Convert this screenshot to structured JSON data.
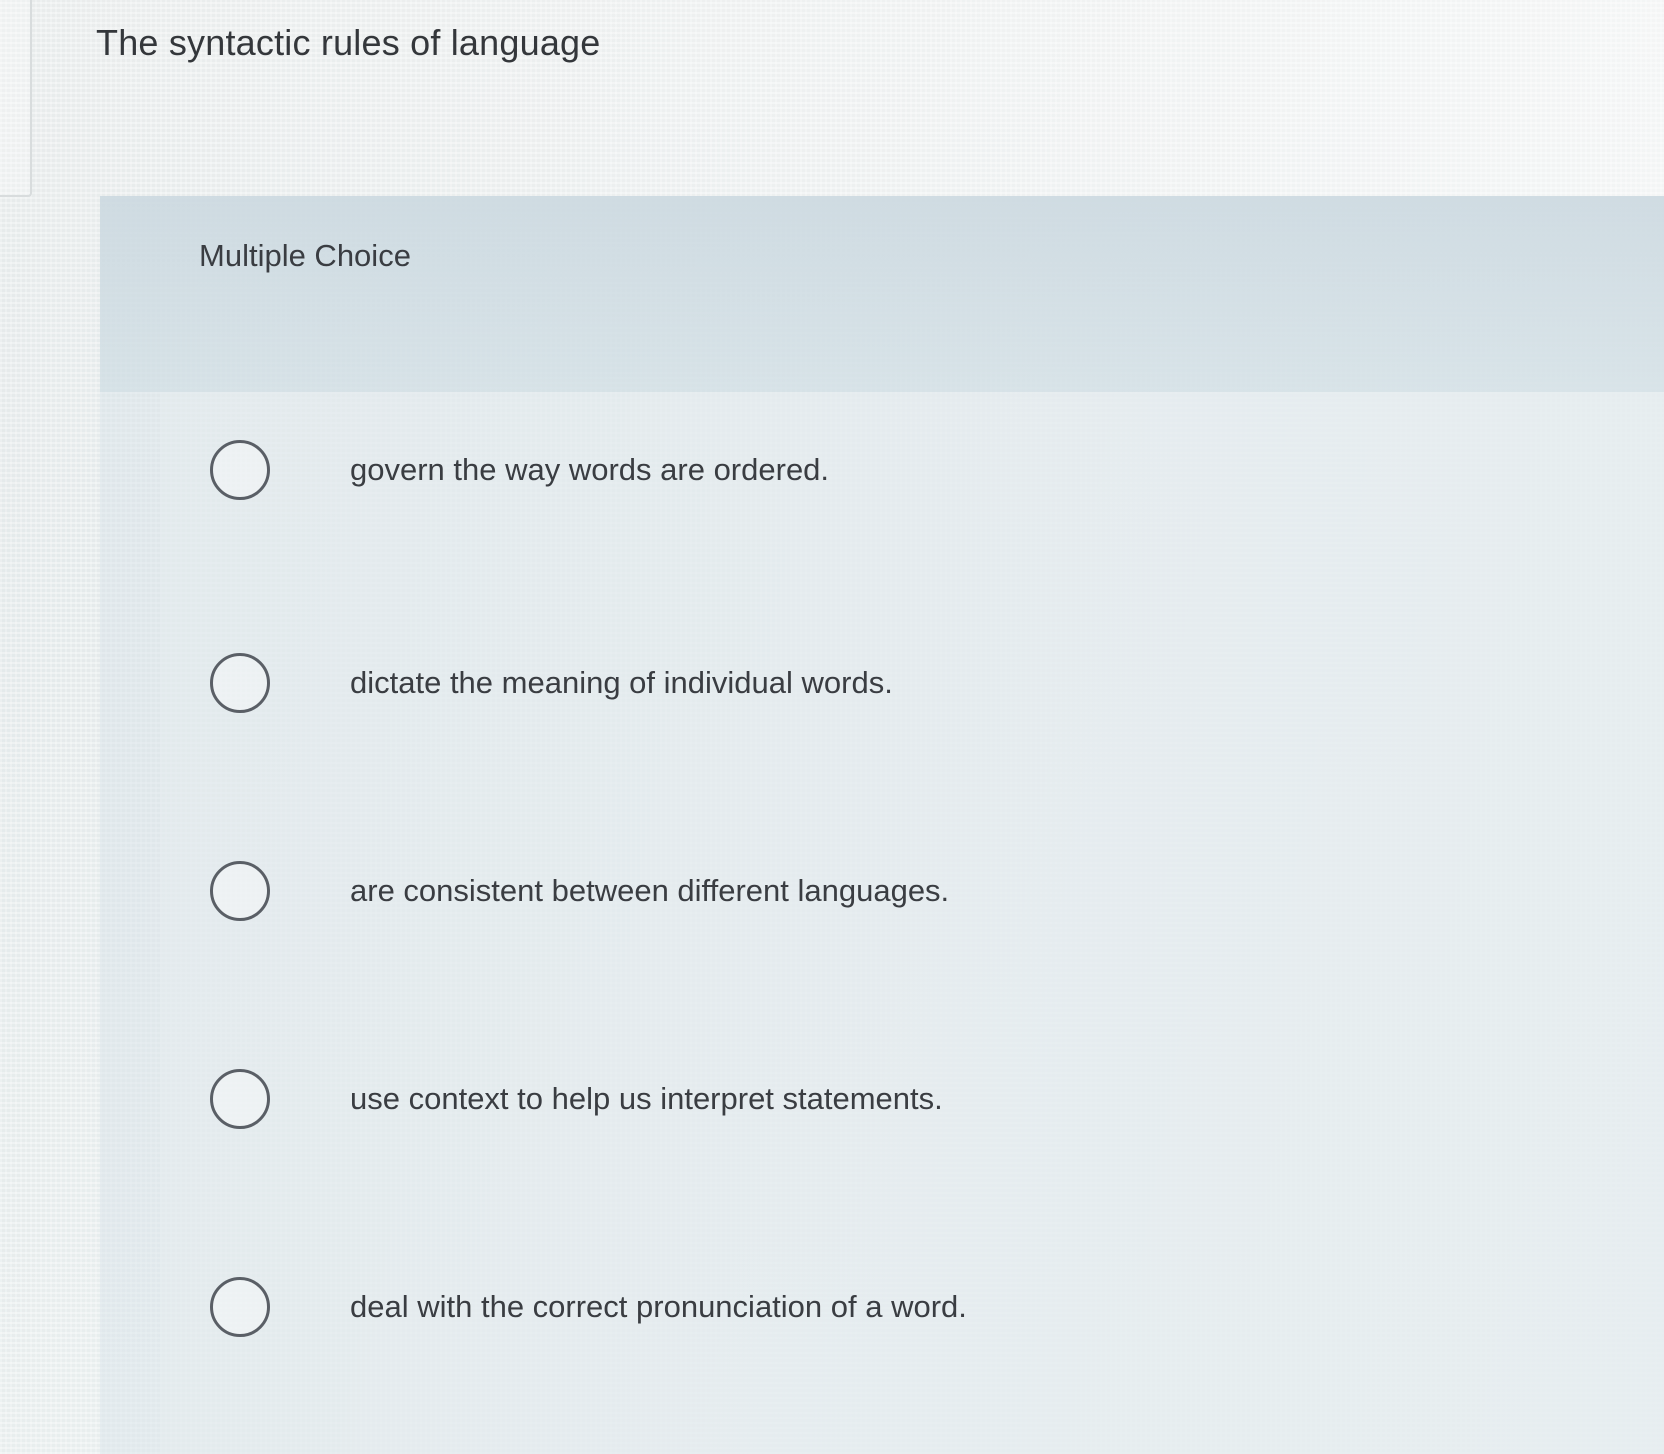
{
  "question": {
    "text": "The syntactic rules of language"
  },
  "panel": {
    "type_label": "Multiple Choice"
  },
  "options": [
    {
      "label": "govern the way words are ordered.",
      "selected": false
    },
    {
      "label": "dictate the meaning of individual words.",
      "selected": false
    },
    {
      "label": "are consistent between different languages.",
      "selected": false
    },
    {
      "label": "use context to help us interpret statements.",
      "selected": false
    },
    {
      "label": "deal with the correct pronunciation of a word.",
      "selected": false
    }
  ],
  "colors": {
    "text": "#3a3d42",
    "radio_border": "#5a5f66",
    "panel_header": "#c8d6de"
  }
}
